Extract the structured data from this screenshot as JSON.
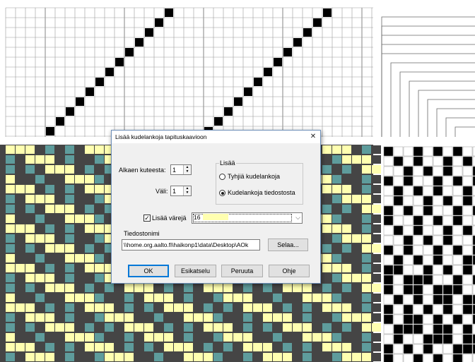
{
  "colors": {
    "dialog_bg": "#f0f0f0",
    "dialog_border": "#6d8fb8",
    "accent": "#0078d7",
    "weave_dark": "#454545",
    "weave_teal": "#5e9c9c",
    "weave_yellow": "#ffffb0",
    "draft_black": "#000000",
    "grid_line": "#9a9a9a"
  },
  "background": {
    "description_icon": "weave-draft-editor",
    "threading_grid": "top-left",
    "tieup_lines": "top-right",
    "fabric_simulation": "bottom-left",
    "treadling_grid": "bottom-right"
  },
  "dialog": {
    "title": "Lisää kudelankoja tapituskaavioon",
    "close_glyph": "✕",
    "start_label": "Alkaen kuteesta:",
    "start_value": "1",
    "interval_label": "Väli:",
    "interval_value": "1",
    "group_title": "Lisää",
    "radio_empty": "Tyhjiä kudelankoja",
    "radio_file": "Kudelankoja tiedostosta",
    "radio_selected": "file",
    "add_colors_label": "Lisää värejä",
    "add_colors_checked": true,
    "check_glyph": "✓",
    "color_number": "16",
    "color_swatch": "#ffffb0",
    "combo_arrow": "⌵",
    "filename_label": "Tiedostonimi",
    "path_value": "\\\\home.org.aalto.fi\\haikonp1\\data\\Desktop\\AOk",
    "browse_button": "Selaa...",
    "ok_button": "OK",
    "preview_button": "Esikatselu",
    "cancel_button": "Peruuta",
    "help_button": "Ohje"
  }
}
